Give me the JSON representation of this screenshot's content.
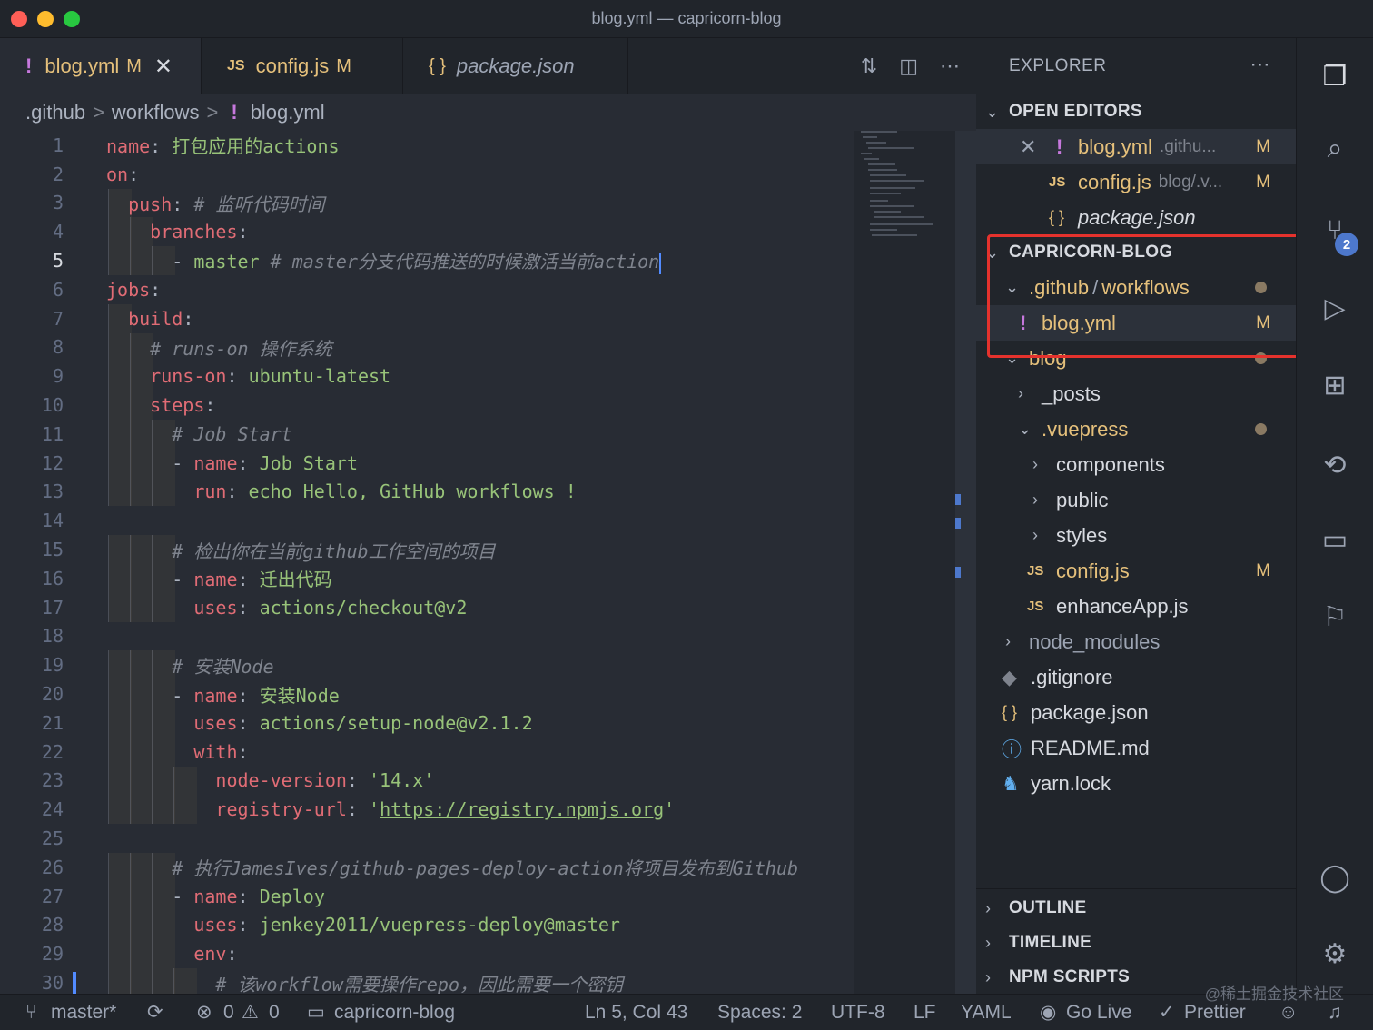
{
  "window": {
    "title": "blog.yml — capricorn-blog"
  },
  "tabs": [
    {
      "label": "blog.yml",
      "status": "M",
      "icon": "!"
    },
    {
      "label": "config.js",
      "status": "M",
      "icon": "JS"
    },
    {
      "label": "package.json",
      "status": "",
      "icon": "{}"
    }
  ],
  "breadcrumb": {
    "parts": [
      ".github",
      "workflows",
      "blog.yml"
    ],
    "sep": ">"
  },
  "editor": {
    "line_numbers": [
      "1",
      "2",
      "3",
      "4",
      "5",
      "6",
      "7",
      "8",
      "9",
      "10",
      "11",
      "12",
      "13",
      "14",
      "15",
      "16",
      "17",
      "18",
      "19",
      "20",
      "21",
      "22",
      "23",
      "24",
      "25",
      "26",
      "27",
      "28",
      "29",
      "30"
    ],
    "lines": [
      {
        "key": "name",
        "colon": ": ",
        "value": "打包应用的actions"
      },
      {
        "key": "on",
        "colon": ":"
      },
      {
        "indent": "  ",
        "key": "push",
        "colon": ": ",
        "comment": "# 监听代码时间"
      },
      {
        "indent": "    ",
        "key": "branches",
        "colon": ":"
      },
      {
        "indent": "      ",
        "dash": "- ",
        "value": "master ",
        "comment": "# master分支代码推送的时候激活当前action"
      },
      {
        "key": "jobs",
        "colon": ":"
      },
      {
        "indent": "  ",
        "key": "build",
        "colon": ":"
      },
      {
        "indent": "    ",
        "comment": "# runs-on 操作系统"
      },
      {
        "indent": "    ",
        "key": "runs-on",
        "colon": ": ",
        "value": "ubuntu-latest"
      },
      {
        "indent": "    ",
        "key": "steps",
        "colon": ":"
      },
      {
        "indent": "      ",
        "comment": "# Job Start"
      },
      {
        "indent": "      ",
        "dash": "- ",
        "key": "name",
        "colon": ": ",
        "value": "Job Start"
      },
      {
        "indent": "        ",
        "key": "run",
        "colon": ": ",
        "value": "echo Hello, GitHub workflows !"
      },
      {},
      {
        "indent": "      ",
        "comment": "# 检出你在当前github工作空间的项目"
      },
      {
        "indent": "      ",
        "dash": "- ",
        "key": "name",
        "colon": ": ",
        "value": "迁出代码"
      },
      {
        "indent": "        ",
        "key": "uses",
        "colon": ": ",
        "value": "actions/checkout@v2"
      },
      {},
      {
        "indent": "      ",
        "comment": "# 安装Node"
      },
      {
        "indent": "      ",
        "dash": "- ",
        "key": "name",
        "colon": ": ",
        "value": "安装Node"
      },
      {
        "indent": "        ",
        "key": "uses",
        "colon": ": ",
        "value": "actions/setup-node@v2.1.2"
      },
      {
        "indent": "        ",
        "key": "with",
        "colon": ":"
      },
      {
        "indent": "          ",
        "key": "node-version",
        "colon": ": ",
        "value": "'14.x'"
      },
      {
        "indent": "          ",
        "key": "registry-url",
        "colon": ": ",
        "q1": "'",
        "link": "https://registry.npmjs.org",
        "q2": "'"
      },
      {},
      {
        "indent": "      ",
        "comment": "# 执行JamesIves/github-pages-deploy-action将项目发布到Github"
      },
      {
        "indent": "      ",
        "dash": "- ",
        "key": "name",
        "colon": ": ",
        "value": "Deploy"
      },
      {
        "indent": "        ",
        "key": "uses",
        "colon": ": ",
        "value": "jenkey2011/vuepress-deploy@master"
      },
      {
        "indent": "        ",
        "key": "env",
        "colon": ":"
      },
      {
        "indent": "          ",
        "comment": "# 该workflow需要操作repo，因此需要一个密钥"
      }
    ]
  },
  "explorer": {
    "title": "EXPLORER",
    "open_editors": {
      "title": "OPEN EDITORS",
      "items": [
        {
          "name": "blog.yml",
          "path": ".githu...",
          "status": "M"
        },
        {
          "name": "config.js",
          "path": "blog/.v...",
          "status": "M"
        },
        {
          "name": "package.json",
          "path": "",
          "status": ""
        }
      ]
    },
    "project": {
      "title": "CAPRICORN-BLOG",
      "github": ".github",
      "slash": "/",
      "workflows": "workflows",
      "blog_yml": "blog.yml",
      "blog_yml_status": "M",
      "blog": "blog",
      "posts": "_posts",
      "vuepress": ".vuepress",
      "components": "components",
      "public": "public",
      "styles": "styles",
      "config_js": "config.js",
      "config_js_status": "M",
      "enhance": "enhanceApp.js",
      "node_modules": "node_modules",
      "gitignore": ".gitignore",
      "package": "package.json",
      "readme": "README.md",
      "yarn": "yarn.lock"
    },
    "outline": "OUTLINE",
    "timeline": "TIMELINE",
    "npm_scripts": "NPM SCRIPTS"
  },
  "activity": {
    "scm_badge": "2"
  },
  "statusbar": {
    "branch": "master*",
    "errors": "0",
    "warnings": "0",
    "folder": "capricorn-blog",
    "position": "Ln 5, Col 43",
    "spaces": "Spaces: 2",
    "encoding": "UTF-8",
    "eol": "LF",
    "language": "YAML",
    "golive": "Go Live",
    "prettier": "Prettier"
  },
  "watermark": "@稀土掘金技术社区",
  "colors": {
    "accent": "#528bff",
    "highlight_box": "#e5322d",
    "modified": "#e5c07b"
  }
}
